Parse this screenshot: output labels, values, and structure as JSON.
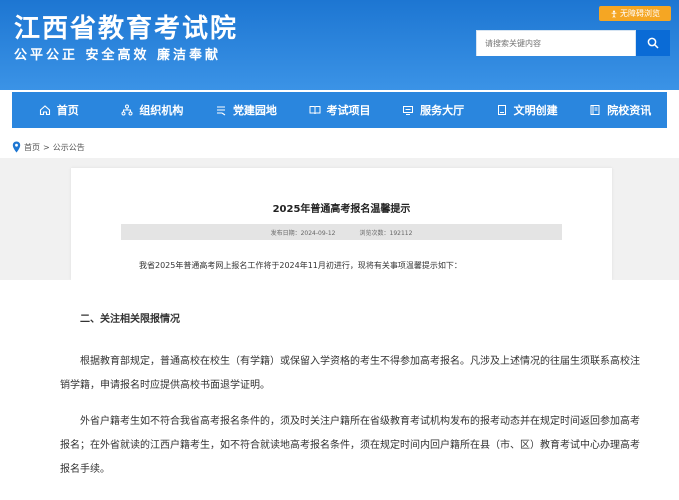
{
  "header": {
    "site_title": "江西省教育考试院",
    "slogan": "公平公正  安全高效  廉洁奉献",
    "accessibility_label": "无障碍浏览",
    "search_placeholder": "请搜索关键内容"
  },
  "nav": {
    "items": [
      {
        "label": "首页",
        "icon": "home-icon"
      },
      {
        "label": "组织机构",
        "icon": "org-chart-icon"
      },
      {
        "label": "党建园地",
        "icon": "party-icon"
      },
      {
        "label": "考试项目",
        "icon": "book-icon"
      },
      {
        "label": "服务大厅",
        "icon": "service-icon"
      },
      {
        "label": "文明创建",
        "icon": "document-icon"
      },
      {
        "label": "院校资讯",
        "icon": "news-icon"
      }
    ]
  },
  "breadcrumb": {
    "home": "首页",
    "separator": ">",
    "current": "公示公告"
  },
  "article": {
    "title": "2025年普通高考报名温馨提示",
    "publish_date_label": "发布日期：",
    "publish_date": "2024-09-12",
    "views_label": "浏览次数：",
    "views": "192112",
    "intro": "我省2025年普通高考网上报名工作将于2024年11月初进行，现将有关事项温馨提示如下："
  },
  "content": {
    "section_heading": "二、关注相关限报情况",
    "paragraph1": "根据教育部规定，普通高校在校生（有学籍）或保留入学资格的考生不得参加高考报名。凡涉及上述情况的往届生须联系高校注销学籍，申请报名时应提供高校书面退学证明。",
    "paragraph2": "外省户籍考生如不符合我省高考报名条件的，须及时关注户籍所在省级教育考试机构发布的报考动态并在规定时间返回参加高考报名；在外省就读的江西户籍考生，如不符合就读地高考报名条件，须在规定时间内回户籍所在县（市、区）教育考试中心办理高考报名手续。"
  },
  "colors": {
    "header_blue": "#1d76d2",
    "nav_blue": "#2a86de",
    "accent_orange": "#f5a623"
  }
}
